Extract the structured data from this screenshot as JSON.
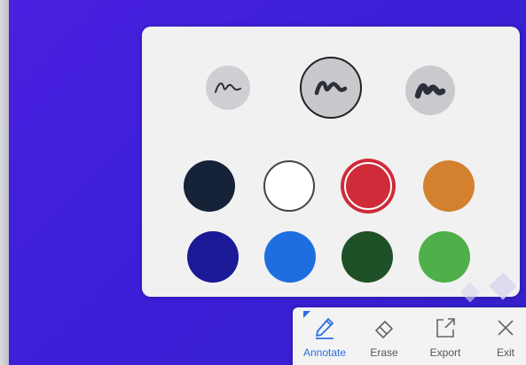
{
  "colors": {
    "swatches_row1": [
      "#162238",
      "#ffffff",
      "#cf2b39",
      "#d4812f"
    ],
    "swatches_row2": [
      "#1a1996",
      "#1e6ee0",
      "#1f5127",
      "#4faf4b"
    ],
    "accent": "#2a6fe0"
  },
  "pen_sizes": [
    "thin",
    "medium",
    "thick"
  ],
  "selected_pen": "medium",
  "selected_color": "#cf2b39",
  "toolbar": {
    "annotate_label": "Annotate",
    "erase_label": "Erase",
    "export_label": "Export",
    "exit_label": "Exit"
  }
}
